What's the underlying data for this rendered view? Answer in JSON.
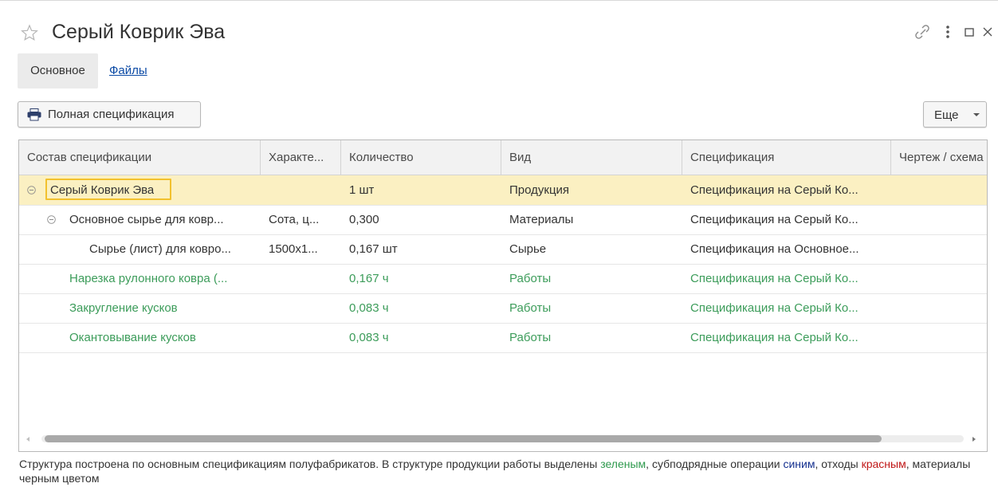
{
  "window": {
    "title": "Серый Коврик Эва"
  },
  "tabs": [
    {
      "label": "Основное",
      "active": true
    },
    {
      "label": "Файлы",
      "active": false
    }
  ],
  "toolbar": {
    "full_spec_label": "Полная спецификация",
    "more_label": "Еще"
  },
  "table": {
    "columns": [
      "Состав спецификации",
      "Характе...",
      "Количество",
      "Вид",
      "Спецификация",
      "Чертеж / схема"
    ],
    "rows": [
      {
        "name": "Серый Коврик Эва",
        "char": "",
        "qty": "1 шт",
        "kind": "Продукция",
        "spec": "Спецификация на Серый Ко...",
        "drawing": "",
        "level": 0,
        "expanded": true,
        "selected": true,
        "color": "black"
      },
      {
        "name": "Основное сырье для ковр...",
        "char": "Сота, ц...",
        "qty": "0,300",
        "kind": "Материалы",
        "spec": "Спецификация на Серый Ко...",
        "drawing": "",
        "level": 1,
        "expanded": true,
        "selected": false,
        "color": "black"
      },
      {
        "name": "Сырье (лист) для ковро...",
        "char": "1500x1...",
        "qty": "0,167 шт",
        "kind": "Сырье",
        "spec": "Спецификация на Основное...",
        "drawing": "",
        "level": 2,
        "expanded": false,
        "selected": false,
        "color": "black"
      },
      {
        "name": "Нарезка рулонного ковра (...",
        "char": "",
        "qty": "0,167 ч",
        "kind": "Работы",
        "spec": "Спецификация на Серый Ко...",
        "drawing": "",
        "level": 1,
        "expanded": false,
        "selected": false,
        "color": "green"
      },
      {
        "name": "Закругление кусков",
        "char": "",
        "qty": "0,083 ч",
        "kind": "Работы",
        "spec": "Спецификация на Серый Ко...",
        "drawing": "",
        "level": 1,
        "expanded": false,
        "selected": false,
        "color": "green"
      },
      {
        "name": "Окантовывание кусков",
        "char": "",
        "qty": "0,083 ч",
        "kind": "Работы",
        "spec": "Спецификация на Серый Ко...",
        "drawing": "",
        "level": 1,
        "expanded": false,
        "selected": false,
        "color": "green"
      }
    ]
  },
  "footer": {
    "part1": "Структура построена по основным спецификациям полуфабрикатов. В структуре продукции работы выделены ",
    "green_word": "зеленым",
    "part2": ", субподрядные операции ",
    "blue_word": "синим",
    "part3": ", отходы ",
    "red_word": "красным",
    "part4": ", материалы черным цветом"
  },
  "colors": {
    "green_text": "#3c9c5a",
    "selected_row_bg": "#fbf0c2",
    "focus_border": "#f2c12e",
    "link_blue": "#0b4aa5",
    "subcontract_blue": "#14308f",
    "waste_red": "#c01818"
  },
  "icons": [
    "star-icon",
    "link-icon",
    "more-vert-icon",
    "maximize-icon",
    "close-icon",
    "printer-icon",
    "chevron-down-icon",
    "collapse-icon"
  ]
}
